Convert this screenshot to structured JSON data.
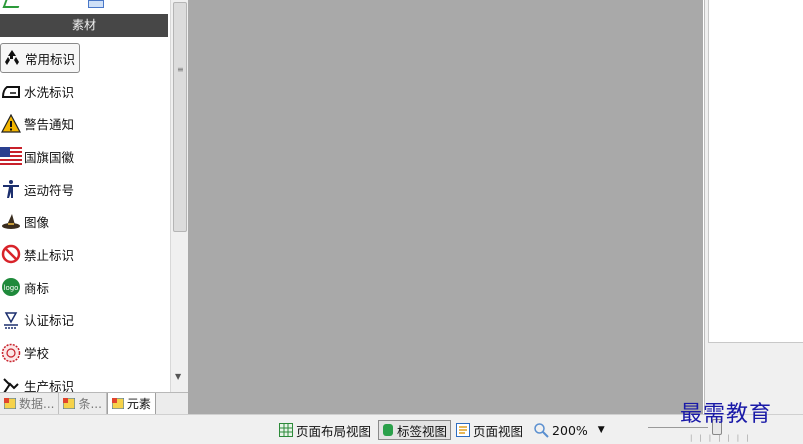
{
  "left_panel": {
    "section_title": "素材",
    "categories": [
      {
        "label": "常用标识",
        "icon": "recycle-icon",
        "selected": true
      },
      {
        "label": "水洗标识",
        "icon": "iron-icon",
        "selected": false
      },
      {
        "label": "警告通知",
        "icon": "warning-icon",
        "selected": false
      },
      {
        "label": "国旗国徽",
        "icon": "flag-icon",
        "selected": false
      },
      {
        "label": "运动符号",
        "icon": "athlete-icon",
        "selected": false
      },
      {
        "label": "图像",
        "icon": "witch-hat-icon",
        "selected": false
      },
      {
        "label": "禁止标识",
        "icon": "prohibition-icon",
        "selected": false
      },
      {
        "label": "商标",
        "icon": "logo-badge-icon",
        "selected": false
      },
      {
        "label": "认证标记",
        "icon": "certification-icon",
        "selected": false
      },
      {
        "label": "学校",
        "icon": "school-emblem-icon",
        "selected": false
      },
      {
        "label": "生产标识",
        "icon": "production-icon",
        "selected": false
      }
    ],
    "badge_text": "logo"
  },
  "bottom_tabs": [
    {
      "label": "数据...",
      "active": false
    },
    {
      "label": "条...",
      "active": false
    },
    {
      "label": "元素",
      "active": true
    }
  ],
  "status_bar": {
    "page_layout_view": "页面布局视图",
    "label_view": "标签视图",
    "page_view": "页面视图",
    "zoom": "200%"
  },
  "watermark": "最需教育",
  "colors": {
    "header_bg": "#474747",
    "canvas_bg": "#a9a9a9",
    "watermark": "#1a1aa8"
  }
}
